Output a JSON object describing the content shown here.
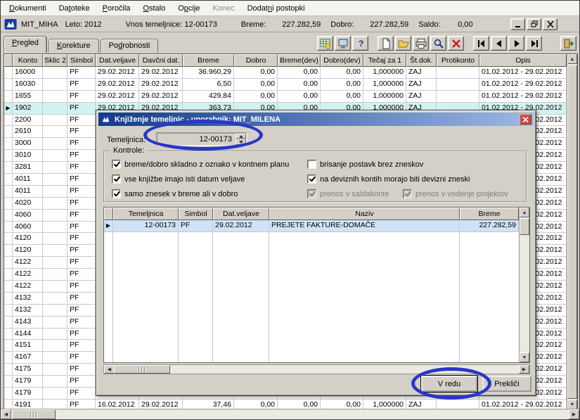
{
  "menu": {
    "items": [
      {
        "label": "Dokumenti",
        "hotkey": 0
      },
      {
        "label": "Datoteke",
        "hotkey": 2
      },
      {
        "label": "Poročila",
        "hotkey": 0
      },
      {
        "label": "Ostalo",
        "hotkey": 0
      },
      {
        "label": "Opcije",
        "hotkey": 1
      },
      {
        "label": "Konec",
        "hotkey": -1,
        "disabled": true
      },
      {
        "label": "Dodatni postopki",
        "hotkey": 5
      }
    ]
  },
  "titlebar": {
    "app_name": "MIT_MIHA",
    "leto": "Leto: 2012",
    "vnos": "Vnos temeljnice: 12-00173",
    "breme_label": "Breme:",
    "breme_value": "227.282,59",
    "dobro_label": "Dobro:",
    "dobro_value": "227.282,59",
    "saldo_label": "Saldo:",
    "saldo_value": "0,00",
    "window_buttons": [
      "minimize",
      "restore",
      "close"
    ]
  },
  "tabs": [
    {
      "label": "Pregled",
      "hotkey": 0,
      "active": true
    },
    {
      "label": "Korekture",
      "hotkey": 0
    },
    {
      "label": "Podrobnosti",
      "hotkey": 2
    }
  ],
  "toolbar": {
    "icons": [
      "ledger-icon",
      "monitor-icon",
      "help-icon",
      "new-document-icon",
      "open-folder-icon",
      "print-icon",
      "search-icon",
      "delete-icon",
      "first-record-icon",
      "previous-record-icon",
      "next-record-icon",
      "last-record-icon",
      "exit-icon"
    ]
  },
  "grid": {
    "columns": [
      "",
      "Konto",
      "Sklic 2",
      "Simbol",
      "Dat.veljave",
      "Davčni dat.",
      "Breme",
      "Dobro",
      "Breme(dev)",
      "Dobro(dev)",
      "Tečaj za 1",
      "Št.dok.",
      "Protikonto",
      "Opis"
    ],
    "rows": [
      {
        "konto": "16000",
        "simbol": "PF",
        "dat_veljave": "29.02.2012",
        "davcni_dat": "29.02.2012",
        "breme": "36.960,29",
        "dobro": "0,00",
        "breme_dev": "0,00",
        "dobro_dev": "0,00",
        "tecaj": "1,000000",
        "st_dok": "ZAJ",
        "opis": "01.02.2012 - 29.02.2012"
      },
      {
        "konto": "16030",
        "simbol": "PF",
        "dat_veljave": "29.02.2012",
        "davcni_dat": "29.02.2012",
        "breme": "6,50",
        "dobro": "0,00",
        "breme_dev": "0,00",
        "dobro_dev": "0,00",
        "tecaj": "1,000000",
        "st_dok": "ZAJ",
        "opis": "01.02.2012 - 29.02.2012"
      },
      {
        "konto": "1655",
        "simbol": "PF",
        "dat_veljave": "29.02.2012",
        "davcni_dat": "29.02.2012",
        "breme": "429,84",
        "dobro": "0,00",
        "breme_dev": "0,00",
        "dobro_dev": "0,00",
        "tecaj": "1,000000",
        "st_dok": "ZAJ",
        "opis": "01.02.2012 - 29.02.2012"
      },
      {
        "marker": "▶",
        "selected": true,
        "konto": "1902",
        "simbol": "PF",
        "dat_veljave": "29.02.2012",
        "davcni_dat": "29.02.2012",
        "breme": "363,73",
        "dobro": "0,00",
        "breme_dev": "0,00",
        "dobro_dev": "0,00",
        "tecaj": "1,000000",
        "st_dok": "ZAJ",
        "opis": "01.02.2012 - 29.02.2012"
      },
      {
        "konto": "2200",
        "simbol": "PF",
        "opis": "01.02.2012 - 29.02.2012"
      },
      {
        "konto": "2610",
        "simbol": "PF",
        "opis": "01.02.2012 - 29.02.2012"
      },
      {
        "konto": "3000",
        "simbol": "PF",
        "opis": "01.02.2012 - 29.02.2012"
      },
      {
        "konto": "3010",
        "simbol": "PF",
        "opis": "01.02.2012 - 29.02.2012"
      },
      {
        "konto": "3281",
        "simbol": "PF",
        "opis": "01.02.2012 - 29.02.2012"
      },
      {
        "konto": "4011",
        "simbol": "PF",
        "opis": "01.02.2012 - 29.02.2012"
      },
      {
        "konto": "4011",
        "simbol": "PF",
        "opis": "01.02.2012 - 29.02.2012"
      },
      {
        "konto": "4020",
        "simbol": "PF",
        "opis": "01.02.2012 - 29.02.2012"
      },
      {
        "konto": "4060",
        "simbol": "PF",
        "opis": "01.02.2012 - 29.02.2012"
      },
      {
        "konto": "4060",
        "simbol": "PF",
        "opis": "01.02.2012 - 29.02.2012"
      },
      {
        "konto": "4120",
        "simbol": "PF",
        "opis": "01.02.2012 - 29.02.2012"
      },
      {
        "konto": "4120",
        "simbol": "PF",
        "opis": "01.02.2012 - 29.02.2012"
      },
      {
        "konto": "4122",
        "simbol": "PF",
        "opis": "01.02.2012 - 29.02.2012"
      },
      {
        "konto": "4122",
        "simbol": "PF",
        "opis": "01.02.2012 - 29.02.2012"
      },
      {
        "konto": "4122",
        "simbol": "PF",
        "opis": "01.02.2012 - 29.02.2012"
      },
      {
        "konto": "4132",
        "simbol": "PF",
        "opis": "01.02.2012 - 29.02.2012"
      },
      {
        "konto": "4132",
        "simbol": "PF",
        "opis": "01.02.2012 - 29.02.2012"
      },
      {
        "konto": "4143",
        "simbol": "PF",
        "opis": "01.02.2012 - 29.02.2012"
      },
      {
        "konto": "4144",
        "simbol": "PF",
        "opis": "01.02.2012 - 29.02.2012"
      },
      {
        "konto": "4151",
        "simbol": "PF",
        "opis": "01.02.2012 - 29.02.2012"
      },
      {
        "konto": "4167",
        "simbol": "PF",
        "opis": "01.02.2012 - 29.02.2012"
      },
      {
        "konto": "4175",
        "simbol": "PF",
        "opis": "01.02.2012 - 29.02.2012"
      },
      {
        "konto": "4179",
        "simbol": "PF",
        "opis": "01.02.2012 - 29.02.2012"
      },
      {
        "konto": "4179",
        "simbol": "PF",
        "opis": "01.02.2012 - 29.02.2012"
      },
      {
        "konto": "4191",
        "simbol": "PF",
        "dat_veljave": "16.02.2012",
        "davcni_dat": "29.02.2012",
        "breme": "37,46",
        "dobro": "0,00",
        "breme_dev": "0,00",
        "dobro_dev": "0,00",
        "tecaj": "1,000000",
        "st_dok": "ZAJ",
        "opis": "01.02.2012 - 29.02.2012"
      }
    ]
  },
  "dialog": {
    "title": "Knjiženje temeljnic - uporabnik: MIT_MILENA",
    "temeljnica_label": "Temeljnica:",
    "temeljnica_value": "12-00173",
    "kontrole_label": "Kontrole:",
    "checks": [
      {
        "label": "breme/dobro skladno z oznako v kontnem planu",
        "checked": true
      },
      {
        "label": "vse knjižbe imajo isti datum veljave",
        "checked": true
      },
      {
        "label": "samo znesek v breme ali v dobro",
        "checked": true
      },
      {
        "label": "brisanje postavk brez zneskov",
        "checked": false
      },
      {
        "label": "na deviznih kontih morajo biti devizni zneski",
        "checked": true
      },
      {
        "label": "prenos v saldakonte",
        "checked": true,
        "disabled": true
      },
      {
        "label": "prenos v vodenje projektov",
        "checked": true,
        "disabled": true
      }
    ],
    "table": {
      "columns": [
        "",
        "Temeljnica",
        "Simbol",
        "Dat.veljave",
        "Naziv",
        "Breme"
      ],
      "rows": [
        {
          "marker": "▶",
          "selected": true,
          "temeljnica": "12-00173",
          "simbol": "PF",
          "dat_veljave": "29.02.2012",
          "naziv": "PREJETE FAKTURE-DOMAČE",
          "breme": "227.282,59"
        }
      ]
    },
    "ok_label": "V redu",
    "cancel_label": "Prekliči"
  },
  "colors": {
    "selected_row": "#d2f2f2",
    "dialog_selected_row": "#cfe3f8",
    "annotation": "#2a36c8",
    "dlg_title_start": "#123a8a",
    "dlg_title_end": "#9cb9e4",
    "app_icon_blue": "#1c3e9c"
  }
}
